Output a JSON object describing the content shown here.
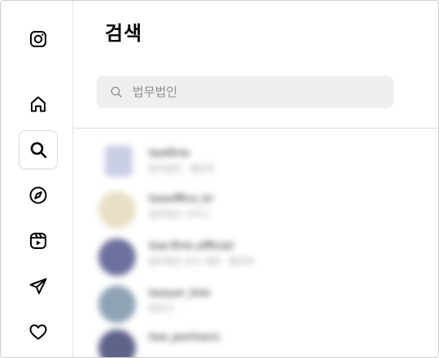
{
  "search": {
    "title": "검색",
    "placeholder": "법무법인"
  },
  "nav": {
    "items": [
      {
        "icon": "instagram-logo-icon"
      },
      {
        "icon": "home-icon"
      },
      {
        "icon": "search-icon",
        "active": true
      },
      {
        "icon": "explore-compass-icon"
      },
      {
        "icon": "reels-icon"
      },
      {
        "icon": "direct-messages-icon"
      },
      {
        "icon": "notifications-heart-icon"
      }
    ]
  },
  "results": [
    {
      "name": "lawfirm",
      "sub": "법무법인 · 팔로우"
    },
    {
      "name": "lawoffice_kr",
      "sub": "법무법인 사무소"
    },
    {
      "name": "law.firm.official",
      "sub": "법무법인 공식 계정 · 팔로워"
    },
    {
      "name": "lawyer_kim",
      "sub": "변호사"
    },
    {
      "name": "law_partners",
      "sub": ""
    }
  ],
  "colors": {
    "background": "#ffffff",
    "search_bg": "#efefef",
    "divider": "#dbdbdb",
    "placeholder": "#8e8e8e"
  }
}
